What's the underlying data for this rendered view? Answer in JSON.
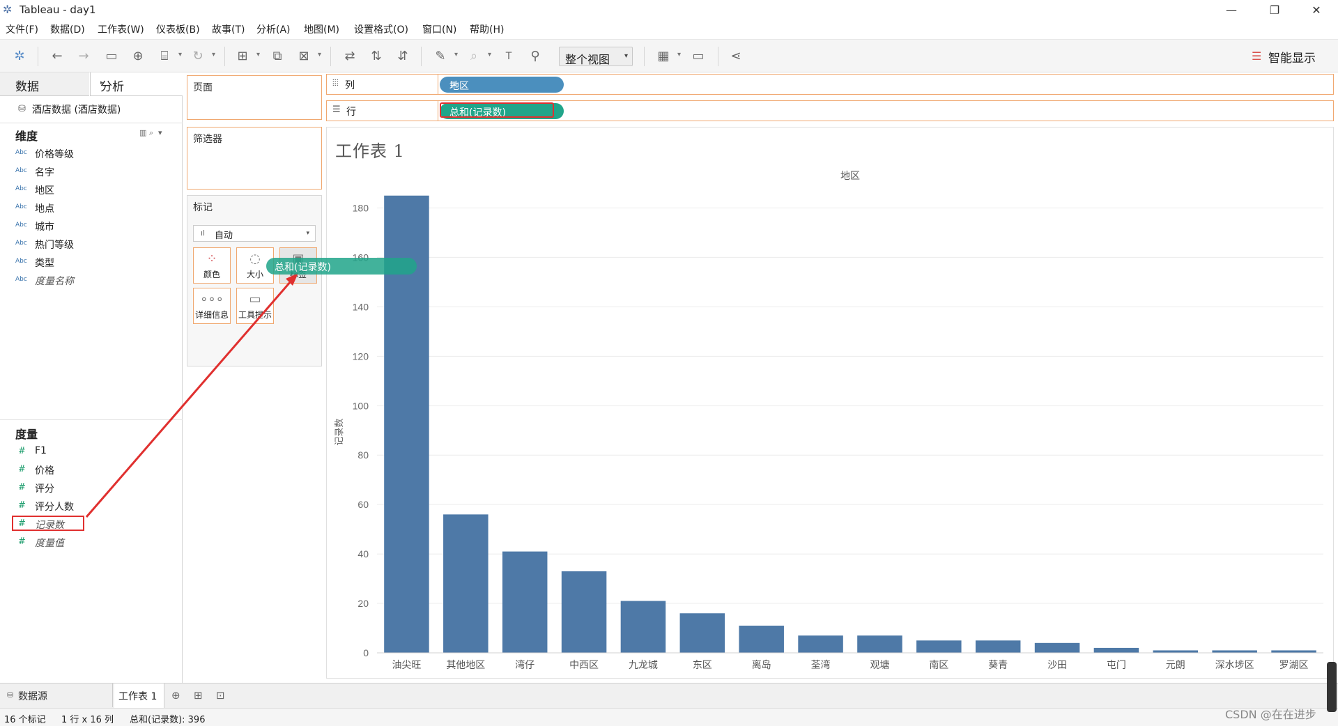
{
  "window": {
    "title": "Tableau - day1",
    "minimize": "—",
    "restore": "❐",
    "close": "✕"
  },
  "menu": [
    "文件(F)",
    "数据(D)",
    "工作表(W)",
    "仪表板(B)",
    "故事(T)",
    "分析(A)",
    "地图(M)",
    "设置格式(O)",
    "窗口(N)",
    "帮助(H)"
  ],
  "toolbar": {
    "view_select": "整个视图",
    "show_me": "智能显示"
  },
  "data_pane": {
    "tab_data": "数据",
    "tab_analysis": "分析",
    "datasource": "酒店数据 (酒店数据)",
    "dimensions_header": "维度",
    "dimensions": [
      {
        "type": "Abc",
        "name": "价格等级"
      },
      {
        "type": "Abc",
        "name": "名字"
      },
      {
        "type": "Abc",
        "name": "地区"
      },
      {
        "type": "Abc",
        "name": "地点"
      },
      {
        "type": "Abc",
        "name": "城市"
      },
      {
        "type": "Abc",
        "name": "热门等级"
      },
      {
        "type": "Abc",
        "name": "类型"
      },
      {
        "type": "Abc",
        "name": "度量名称"
      }
    ],
    "measures_header": "度量",
    "measures": [
      {
        "type": "#",
        "name": "F1"
      },
      {
        "type": "#",
        "name": "价格"
      },
      {
        "type": "#",
        "name": "评分"
      },
      {
        "type": "#",
        "name": "评分人数"
      },
      {
        "type": "#",
        "name": "记录数"
      },
      {
        "type": "#",
        "name": "度量值"
      }
    ]
  },
  "cards": {
    "pages": "页面",
    "filters": "筛选器",
    "marks": "标记",
    "marks_type": "自动",
    "buttons": [
      "颜色",
      "大小",
      "标签",
      "详细信息",
      "工具提示"
    ],
    "drag_pill": "总和(记录数)"
  },
  "shelves": {
    "columns_label": "列",
    "columns_pill": "地区",
    "rows_label": "行",
    "rows_pill": "总和(记录数)"
  },
  "sheet": {
    "title": "工作表 1"
  },
  "chart_data": {
    "type": "bar",
    "xlabel": "地区",
    "ylabel": "记录数",
    "ylim": [
      0,
      190
    ],
    "yticks": [
      0,
      20,
      40,
      60,
      80,
      100,
      120,
      140,
      160,
      180
    ],
    "categories": [
      "油尖旺",
      "其他地区",
      "湾仔",
      "中西区",
      "九龙城",
      "东区",
      "离岛",
      "荃湾",
      "观塘",
      "南区",
      "葵青",
      "沙田",
      "屯门",
      "元朗",
      "深水埗区",
      "罗湖区"
    ],
    "values": [
      185,
      56,
      41,
      33,
      21,
      16,
      11,
      7,
      7,
      5,
      5,
      4,
      2,
      1,
      1,
      1
    ],
    "bar_color": "#4e79a7",
    "grid": true
  },
  "tabs": {
    "datasource": "数据源",
    "sheet1": "工作表 1"
  },
  "status": {
    "marks": "16 个标记",
    "dims": "1 行 x 16 列",
    "sum": "总和(记录数): 396"
  },
  "watermark": "CSDN @在在进步"
}
